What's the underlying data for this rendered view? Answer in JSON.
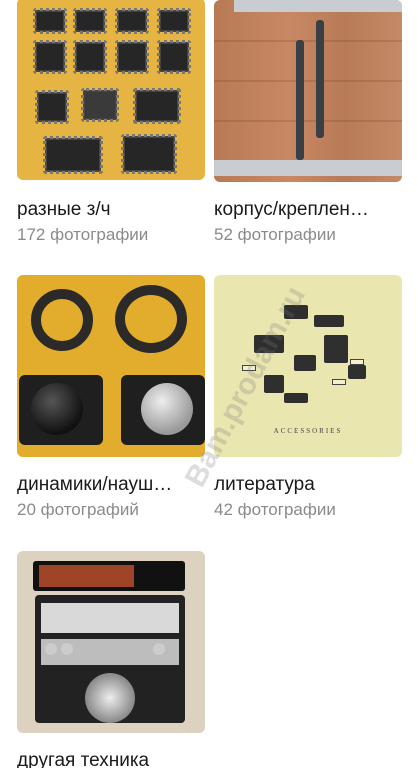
{
  "albums": [
    {
      "title": "разные з/ч",
      "count": "172 фотографии"
    },
    {
      "title": "корпус/креплен…",
      "count": "52 фотографии"
    },
    {
      "title": "динамики/науш…",
      "count": "20 фотографий"
    },
    {
      "title": "литература",
      "count": "42 фотографии"
    },
    {
      "title": "другая техника",
      "count": ""
    }
  ],
  "literature_cover_text": "ACCESSORIES",
  "watermark": "Bam.prodam.ru",
  "colors": {
    "background": "#ffffff",
    "title_text": "#1a1a1a",
    "count_text": "#8a8a8a"
  }
}
